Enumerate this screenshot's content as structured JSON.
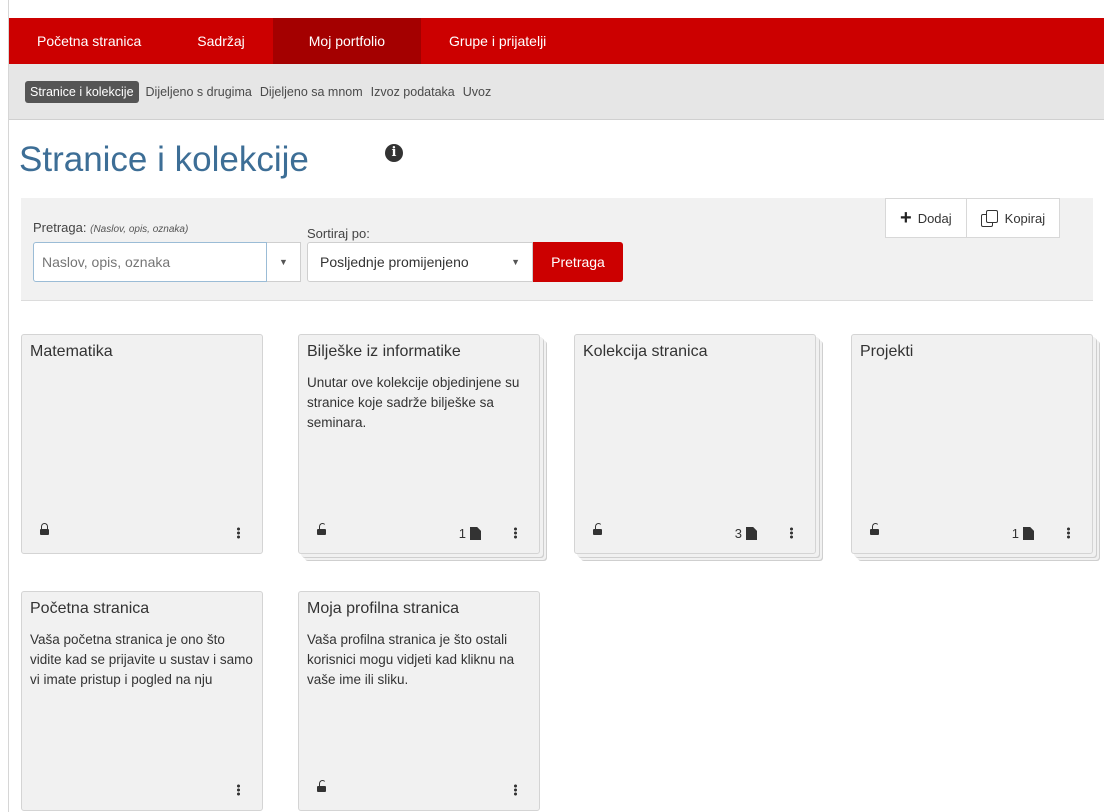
{
  "topnav": {
    "items": [
      {
        "label": "Početna stranica"
      },
      {
        "label": "Sadržaj"
      },
      {
        "label": "Moj portfolio"
      },
      {
        "label": "Grupe i prijatelji"
      }
    ]
  },
  "subnav": {
    "items": [
      {
        "label": "Stranice i kolekcije"
      },
      {
        "label": "Dijeljeno s drugima"
      },
      {
        "label": "Dijeljeno sa mnom"
      },
      {
        "label": "Izvoz podataka"
      },
      {
        "label": "Uvoz"
      }
    ]
  },
  "page": {
    "title": "Stranice i kolekcije"
  },
  "search": {
    "label": "Pretraga:",
    "hint": "(Naslov, opis, oznaka)",
    "placeholder": "Naslov, opis, oznaka",
    "sort_label": "Sortiraj po:",
    "sort_value": "Posljednje promijenjeno",
    "button": "Pretraga"
  },
  "toolbar": {
    "add": "Dodaj",
    "copy": "Kopiraj"
  },
  "cards": [
    {
      "title": "Matematika",
      "desc": "",
      "count": ""
    },
    {
      "title": "Bilješke iz informatike",
      "desc": "Unutar ove kolekcije objedinjene su stranice koje sadrže bilješke sa seminara.",
      "count": "1"
    },
    {
      "title": "Kolekcija stranica",
      "desc": "",
      "count": "3"
    },
    {
      "title": "Projekti",
      "desc": "",
      "count": "1"
    },
    {
      "title": "Početna stranica",
      "desc": "Vaša početna stranica je ono što vidite kad se prijavite u sustav i samo vi imate pristup i pogled na nju",
      "count": ""
    },
    {
      "title": "Moja profilna stranica",
      "desc": "Vaša profilna stranica je što ostali korisnici mogu vidjeti kad kliknu na vaše ime ili sliku.",
      "count": ""
    }
  ],
  "colors": {
    "brand": "#cc0000",
    "brand_active": "#a40000",
    "title": "#3d6e96"
  },
  "icons": [
    "info-icon",
    "plus-icon",
    "copy-icon",
    "lock-icon",
    "unlock-icon",
    "page-icon",
    "kebab-icon",
    "chevron-down-icon"
  ]
}
